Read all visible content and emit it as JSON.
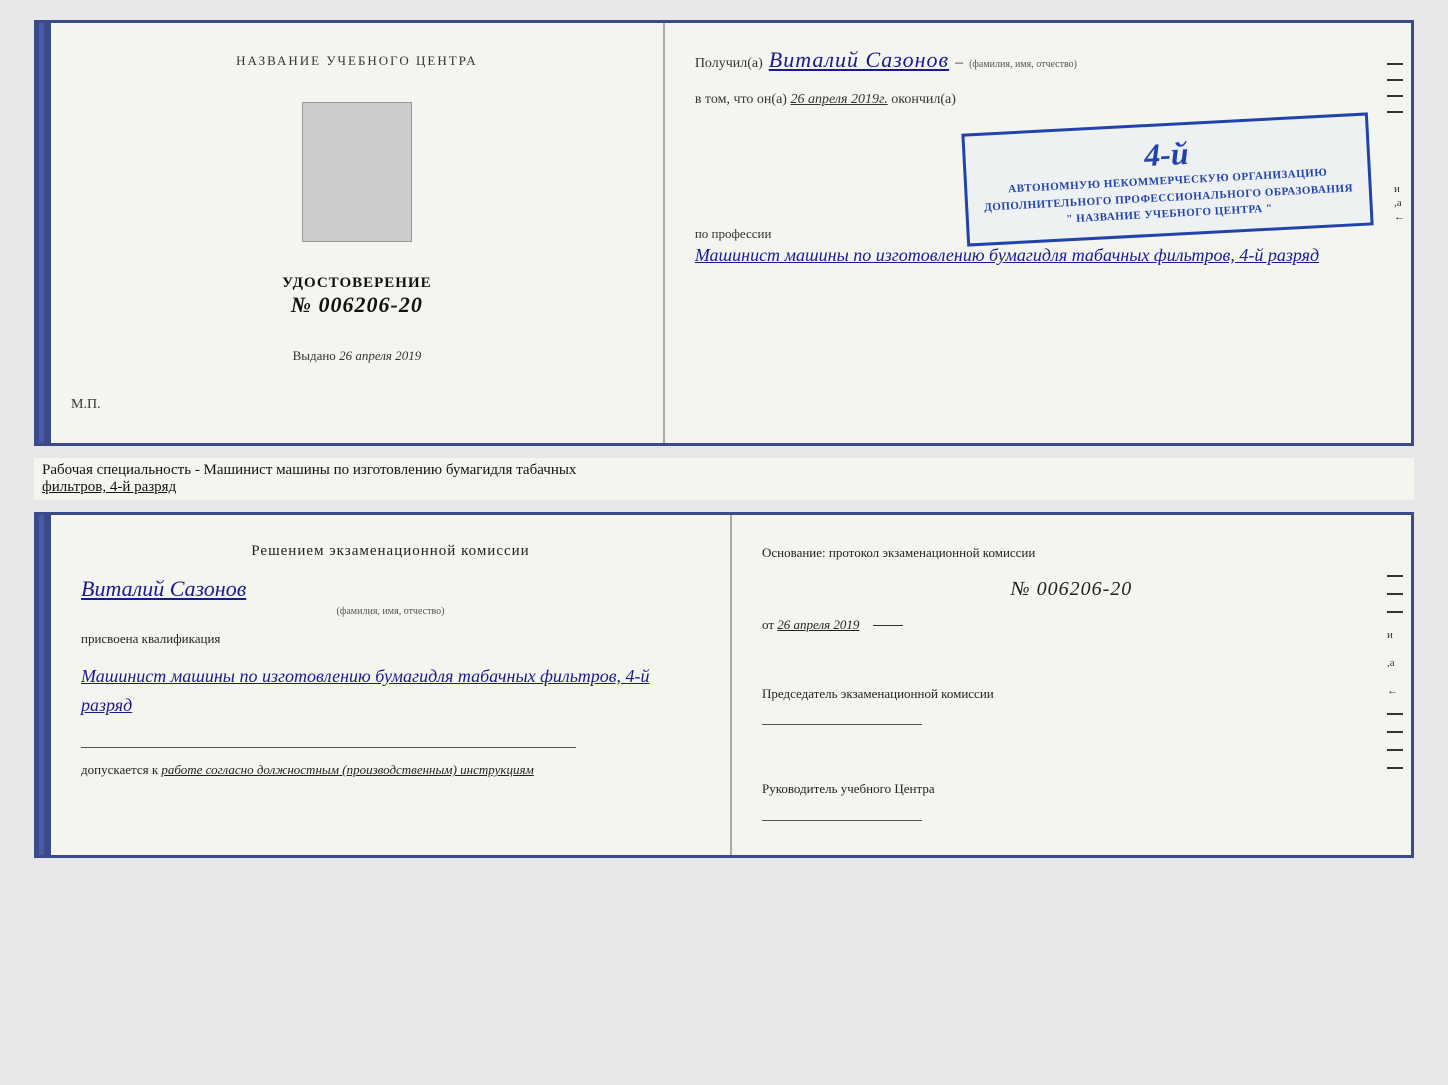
{
  "top_left": {
    "header": "НАЗВАНИЕ УЧЕБНОГО ЦЕНТРА",
    "cert_label": "УДОСТОВЕРЕНИЕ",
    "cert_number": "№ 006206-20",
    "issued_label": "Выдано",
    "issued_date": "26 апреля 2019",
    "mp": "М.П."
  },
  "top_right": {
    "received_label": "Получил(а)",
    "recipient_name": "Виталий Сазонов",
    "name_sub": "(фамилия, имя, отчество)",
    "body_intro": "в том, что он(а)",
    "body_date": "26 апреля 2019г.",
    "finished_label": "окончил(а)",
    "stamp_line1": "АВТОНОМНУЮ НЕКОММЕРЧЕСКУЮ ОРГАНИЗАЦИЮ",
    "stamp_line2": "ДОПОЛНИТЕЛЬНОГО ПРОФЕССИОНАЛЬНОГО ОБРАЗОВАНИЯ",
    "stamp_line3": "\" НАЗВАНИЕ УЧЕБНОГО ЦЕНТРА \"",
    "stamp_number": "4-й",
    "profession_label": "по профессии",
    "profession": "Машинист машины по изготовлению бумагидля табачных фильтров, 4-й разряд"
  },
  "bottom_label": {
    "text": "Рабочая специальность - Машинист машины по изготовлению бумагидля табачных",
    "text2": "фильтров, 4-й разряд"
  },
  "exam_left": {
    "commission_title": "Решением экзаменационной комиссии",
    "person_name": "Виталий Сазонов",
    "name_sub": "(фамилия, имя, отчество)",
    "qualification_label": "присвоена квалификация",
    "profession": "Машинист машины по изготовлению бумагидля табачных фильтров, 4-й разряд",
    "allowed_label": "допускается к",
    "allowed_text": "работе согласно должностным (производственным) инструкциям"
  },
  "exam_right": {
    "basis_label": "Основание: протокол экзаменационной комиссии",
    "number": "№ 006206-20",
    "date_prefix": "от",
    "date": "26 апреля 2019",
    "chairman_label": "Председатель экзаменационной комиссии",
    "director_label": "Руководитель учебного Центра"
  }
}
